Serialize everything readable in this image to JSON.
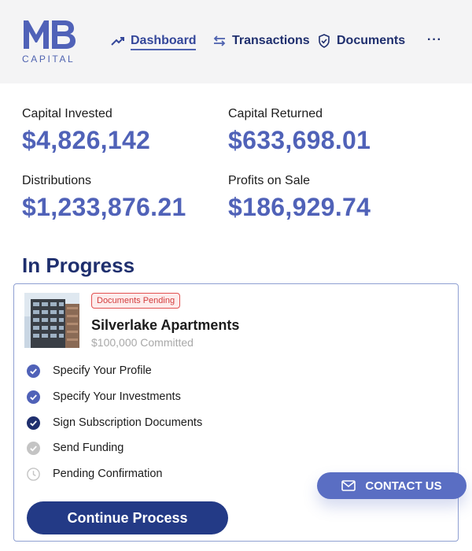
{
  "brand": {
    "mark": "MB",
    "sub": "CAPITAL",
    "color": "#5062b8"
  },
  "nav": {
    "items": [
      {
        "label": "Dashboard",
        "icon": "trend-up-icon",
        "active": true
      },
      {
        "label": "Transactions",
        "icon": "swap-arrows-icon",
        "active": false
      },
      {
        "label": "Documents",
        "icon": "shield-check-icon",
        "active": false
      }
    ],
    "more_label": "···"
  },
  "stats": {
    "capital_invested": {
      "label": "Capital Invested",
      "value": "$4,826,142"
    },
    "capital_returned": {
      "label": "Capital Returned",
      "value": "$633,698.01"
    },
    "distributions": {
      "label": "Distributions",
      "value": "$1,233,876.21"
    },
    "profits_on_sale": {
      "label": "Profits on Sale",
      "value": "$186,929.74"
    }
  },
  "in_progress": {
    "title": "In Progress",
    "investment": {
      "status_badge": "Documents Pending",
      "name": "Silverlake Apartments",
      "committed": "$100,000 Committed",
      "steps": [
        {
          "label": "Specify Your Profile",
          "state": "complete",
          "icon": "check-circle-icon"
        },
        {
          "label": "Specify Your Investments",
          "state": "complete",
          "icon": "check-circle-icon"
        },
        {
          "label": "Sign Subscription Documents",
          "state": "current",
          "icon": "check-circle-icon"
        },
        {
          "label": "Send Funding",
          "state": "pending",
          "icon": "check-circle-gray-icon"
        },
        {
          "label": "Pending Confirmation",
          "state": "pending",
          "icon": "clock-icon"
        }
      ],
      "continue_label": "Continue Process"
    }
  },
  "contact": {
    "label": "CONTACT US",
    "icon": "mail-icon"
  },
  "colors": {
    "accent": "#5062b8",
    "navy": "#1f2f6e",
    "button_dark": "#233a86",
    "badge_red": "#d33c3c"
  }
}
